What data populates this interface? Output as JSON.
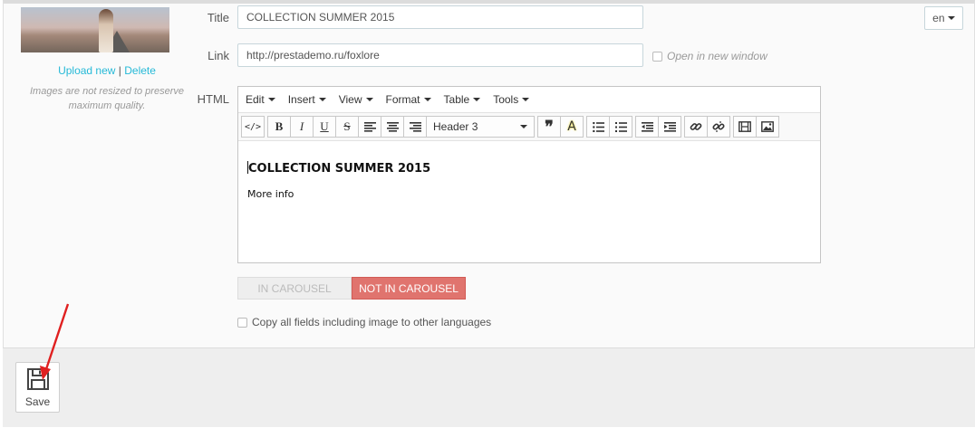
{
  "image_panel": {
    "upload_new": "Upload new",
    "separator": "|",
    "delete": "Delete",
    "note": "Images are not resized to preserve maximum quality."
  },
  "form": {
    "title_label": "Title",
    "title_value": "COLLECTION  SUMMER 2015",
    "link_label": "Link",
    "link_value": "http://prestademo.ru/foxlore",
    "open_new_window_label": "Open in new window",
    "html_label": "HTML",
    "language": "en"
  },
  "editor": {
    "menus": [
      "Edit",
      "Insert",
      "View",
      "Format",
      "Table",
      "Tools"
    ],
    "format_value": "Header 3",
    "heading": "COLLECTION SUMMER 2015",
    "paragraph": "More info"
  },
  "carousel": {
    "in_label": "IN CAROUSEL",
    "out_label": "NOT IN CAROUSEL",
    "active": "NOT IN CAROUSEL",
    "active_color": "#e0746e"
  },
  "copy_fields_label": "Copy all fields including image to other languages",
  "footer": {
    "save_label": "Save"
  },
  "annotation": {
    "arrow_color": "#e02020"
  }
}
